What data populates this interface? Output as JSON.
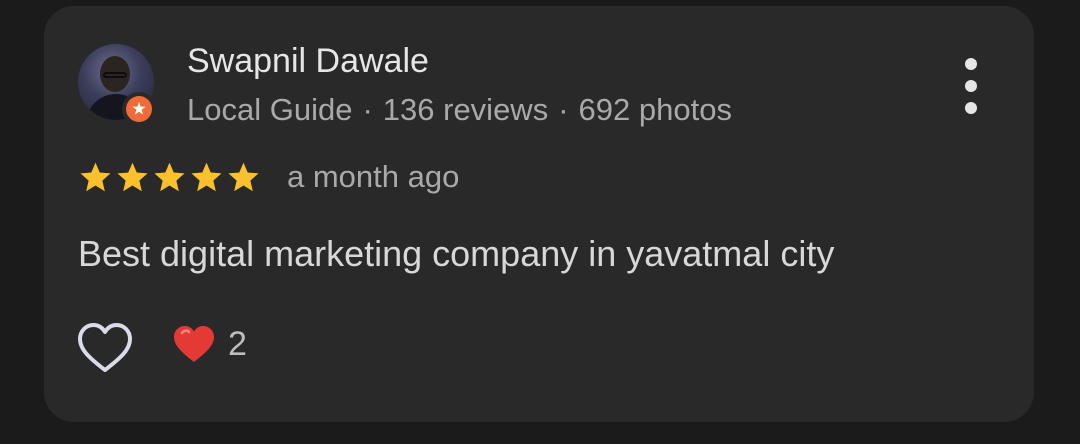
{
  "review": {
    "reviewer_name": "Swapnil Dawale",
    "reviewer_level": "Local Guide",
    "separator": "·",
    "reviews_count": "136 reviews",
    "photos_count": "692 photos",
    "rating": 5,
    "time_ago": "a month ago",
    "text": "Best digital marketing company in yavatmal city",
    "reaction_count": "2"
  },
  "icons": {
    "avatar": "reviewer-avatar",
    "badge": "local-guide-badge-icon",
    "more": "more-vert-icon",
    "star": "star-icon",
    "like": "heart-outline-icon",
    "reaction": "red-heart-icon"
  },
  "colors": {
    "background": "#1b1b1b",
    "card": "#292929",
    "star": "#fbc02d",
    "badge": "#f06b3a",
    "heart": "#e53935"
  }
}
